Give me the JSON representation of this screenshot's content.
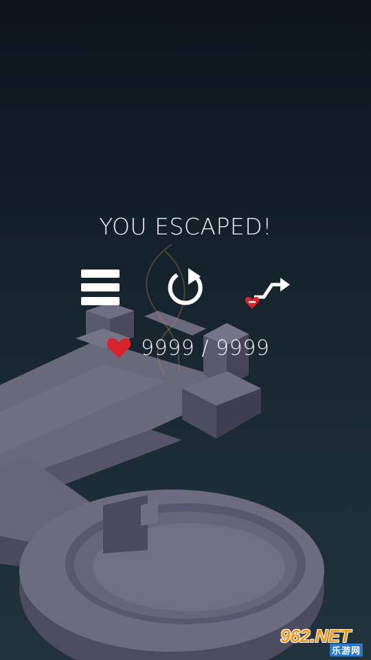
{
  "result": {
    "title": "YOU ESCAPED!"
  },
  "controls": {
    "menu_icon": "hamburger-menu-icon",
    "restart_icon": "restart-arrow-icon",
    "skip_icon": "skip-level-arrow-icon",
    "skip_cost_icon": "heart-minus-icon"
  },
  "lives": {
    "icon": "heart-icon",
    "text": "9999 / 9999",
    "heart_color": "#d9232b"
  },
  "watermark": {
    "main": "962.NET",
    "sub": "乐游网"
  },
  "colors": {
    "background_top": "#0b141b",
    "background_bottom": "#22323d",
    "block_top": "#6b6a7d",
    "block_side": "#4b4a5e",
    "block_dark": "#3b3a4c"
  }
}
